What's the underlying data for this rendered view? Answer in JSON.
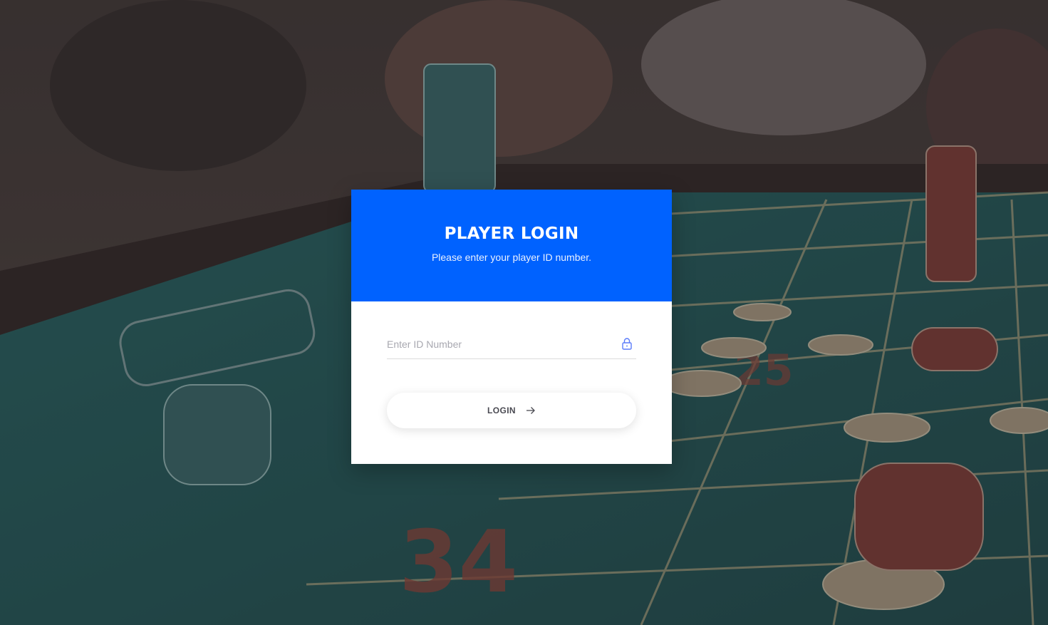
{
  "login": {
    "title": "PLAYER LOGIN",
    "subtitle": "Please enter your player ID number.",
    "id_field": {
      "placeholder": "Enter ID Number",
      "value": "",
      "icon": "lock-icon"
    },
    "button": {
      "label": "LOGIN",
      "icon": "arrow-right-icon"
    }
  },
  "colors": {
    "header_blue": "#0062ff",
    "felt_green": "#2f6b66"
  }
}
